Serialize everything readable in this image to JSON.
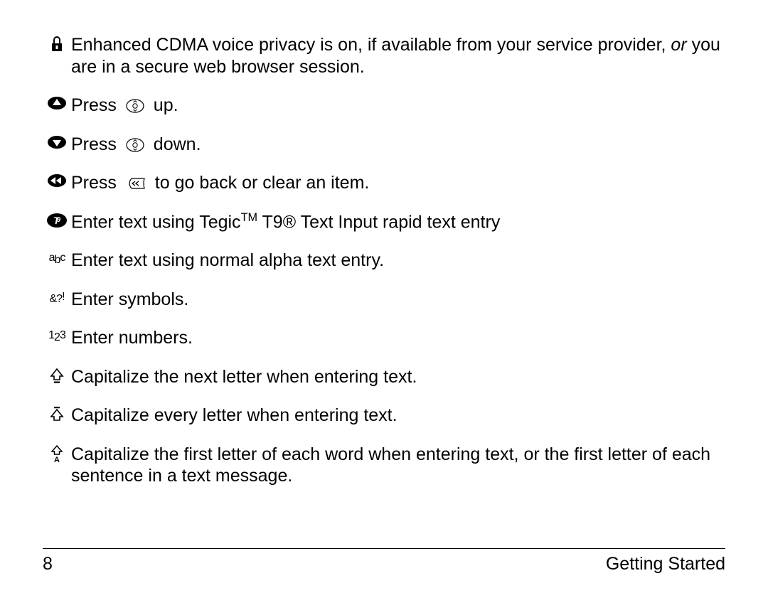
{
  "items": [
    {
      "text": "Enhanced CDMA voice privacy is on, if available from your service provider, <span class=\"em\">or</span> you are in a secure web browser session."
    },
    {
      "text": "Press <span class=\"inline-icon\"><svg width=\"26\" height=\"20\" viewBox=\"0 0 26 20\"><ellipse cx=\"13\" cy=\"10\" rx=\"12\" ry=\"9\" fill=\"none\" stroke=\"#000\" stroke-width=\"1.2\"/><ellipse cx=\"13\" cy=\"10\" rx=\"3.2\" ry=\"3.2\" fill=\"none\" stroke=\"#000\" stroke-width=\"1\"/><polyline points=\"10.5,5 13,2.8 15.5,5\" fill=\"none\" stroke=\"#000\" stroke-width=\"1\"/><polyline points=\"10.5,15 13,17.2 15.5,15\" fill=\"none\" stroke=\"#000\" stroke-width=\"1\"/></svg></span> up."
    },
    {
      "text": "Press <span class=\"inline-icon\"><svg width=\"26\" height=\"20\" viewBox=\"0 0 26 20\"><ellipse cx=\"13\" cy=\"10\" rx=\"12\" ry=\"9\" fill=\"none\" stroke=\"#000\" stroke-width=\"1.2\"/><ellipse cx=\"13\" cy=\"10\" rx=\"3.2\" ry=\"3.2\" fill=\"none\" stroke=\"#000\" stroke-width=\"1\"/><polyline points=\"10.5,5 13,2.8 15.5,5\" fill=\"none\" stroke=\"#000\" stroke-width=\"1\"/><polyline points=\"10.5,15 13,17.2 15.5,15\" fill=\"none\" stroke=\"#000\" stroke-width=\"1\"/></svg></span> down."
    },
    {
      "text": "Press <span class=\"inline-icon\"><svg width=\"28\" height=\"20\" viewBox=\"0 0 28 20\"><path d=\"M8 3 Q2 10 8 17 L26 17 Q24 10 26 3 Z\" fill=\"none\" stroke=\"#000\" stroke-width=\"1.2\"/><polyline points=\"13,7 9,10 13,13\" fill=\"none\" stroke=\"#000\" stroke-width=\"1.3\"/><polyline points=\"18,7 14,10 18,13\" fill=\"none\" stroke=\"#000\" stroke-width=\"1.3\"/></svg></span> to go back or clear an item."
    },
    {
      "text": "Enter text using Tegic<span class=\"sup\">TM</span> T9® Text Input rapid text entry"
    },
    {
      "text": "Enter text using normal alpha text entry."
    },
    {
      "text": "Enter symbols."
    },
    {
      "text": "Enter numbers."
    },
    {
      "text": "Capitalize the next letter when entering text."
    },
    {
      "text": "Capitalize every letter when entering text."
    },
    {
      "text": "Capitalize the first letter of each word when entering text, or the first letter of each sentence in a text message."
    }
  ],
  "footer": {
    "page": "8",
    "section": "Getting Started"
  }
}
